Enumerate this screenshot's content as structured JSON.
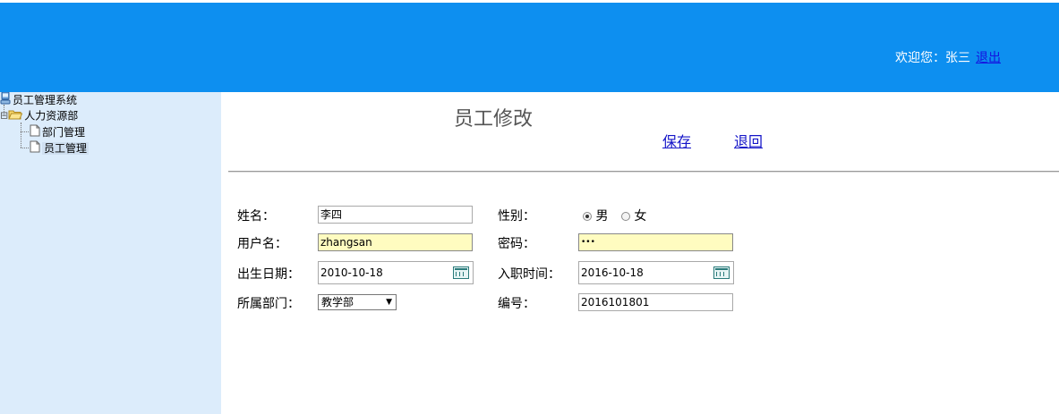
{
  "header": {
    "welcome_text": "欢迎您：张三",
    "logout_label": "退出",
    "bg_color": "#0d8ff0"
  },
  "sidebar": {
    "root": {
      "label": "员工管理系统",
      "icon": "computer-icon"
    },
    "department": {
      "label": "人力资源部",
      "icon": "folder-open-icon",
      "expander": "⊟"
    },
    "items": [
      {
        "label": "部门管理",
        "icon": "page-icon",
        "selected": false
      },
      {
        "label": "员工管理",
        "icon": "page-icon",
        "selected": true
      }
    ]
  },
  "main": {
    "title": "员工修改",
    "actions": {
      "save_label": "保存",
      "back_label": "退回"
    }
  },
  "form": {
    "name": {
      "label": "姓名：",
      "value": "李四"
    },
    "gender": {
      "label": "性别：",
      "options": [
        "男",
        "女"
      ],
      "selected": "男"
    },
    "username": {
      "label": "用户名：",
      "value": "zhangsan"
    },
    "password": {
      "label": "密码：",
      "value": "•••"
    },
    "birthdate": {
      "label": "出生日期：",
      "value": "2010-10-18"
    },
    "hire_date": {
      "label": "入职时间：",
      "value": "2016-10-18"
    },
    "department": {
      "label": "所属部门：",
      "selected": "教学部"
    },
    "employee_no": {
      "label": "编号：",
      "value": "2016101801"
    }
  }
}
